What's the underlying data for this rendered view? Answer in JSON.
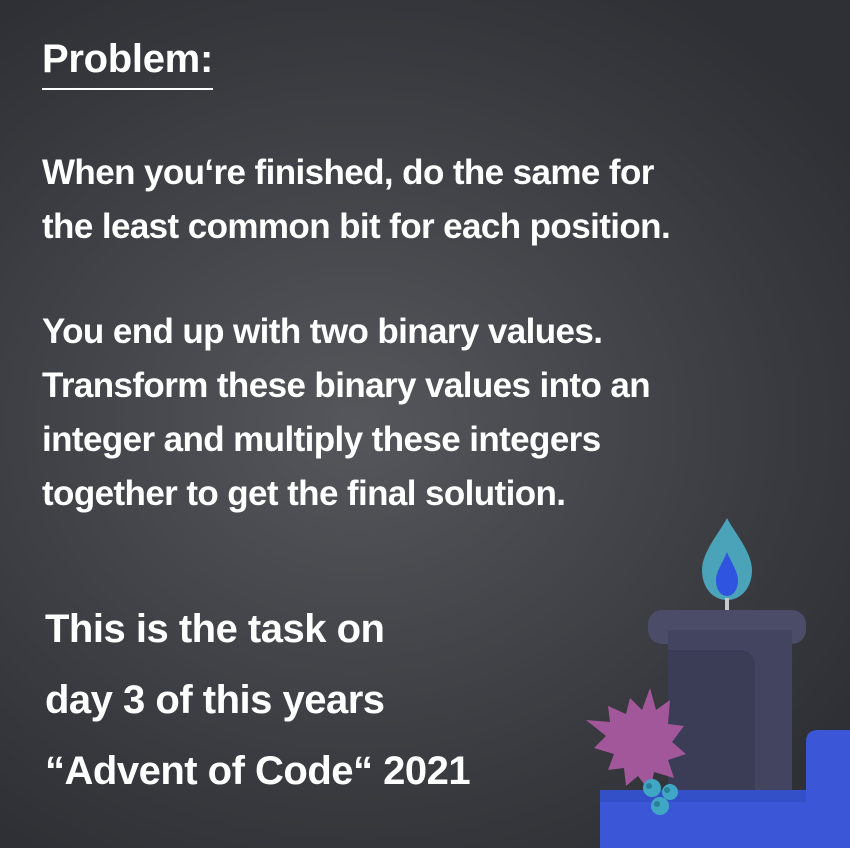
{
  "heading": "Problem:",
  "paragraph1": [
    "When you‘re finished, do the same for",
    "the least common bit for each position."
  ],
  "paragraph2": [
    "You end up with two binary values.",
    "Transform these binary values into an",
    "integer and multiply these integers",
    "together to get the final solution."
  ],
  "task_info": [
    "This is the task on",
    "day 3 of this years",
    "“Advent of Code“ 2021"
  ],
  "illustration": {
    "name": "candle-with-holly-icon",
    "colors": {
      "background": "#3d3f44",
      "flame_outer": "#4aa3b8",
      "flame_inner": "#2f54e0",
      "candle": "#4a4c68",
      "holder": "#3b56d6",
      "holly_leaf": "#a2579b",
      "berries": "#3fa6c4"
    }
  }
}
